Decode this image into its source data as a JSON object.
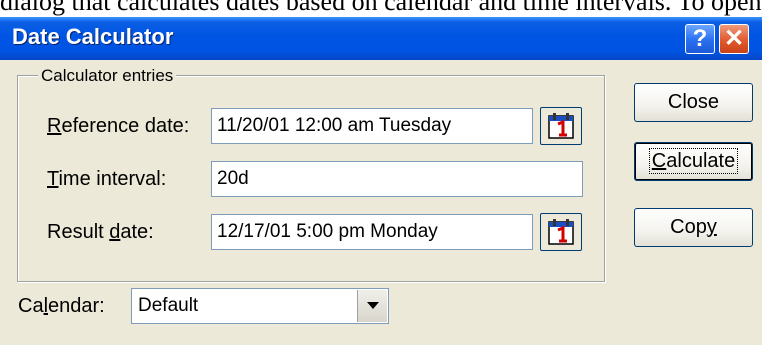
{
  "document": {
    "clipped_text": "dialog that calculates dates based on calendar and time intervals. To open it: Tools > Date Calculator"
  },
  "window": {
    "title": "Date Calculator",
    "help_glyph": "?",
    "close_glyph": "✕"
  },
  "group": {
    "legend": "Calculator entries"
  },
  "fields": {
    "reference": {
      "label_mnemonic": "R",
      "label_rest": "eference date:",
      "value": "11/20/01 12:00 am Tuesday"
    },
    "interval": {
      "label_mnemonic": "T",
      "label_rest": "ime interval:",
      "value": "20d"
    },
    "result": {
      "label_prefix": "Result ",
      "label_mnemonic": "d",
      "label_rest": "ate:",
      "value": "12/17/01 5:00 pm Monday"
    }
  },
  "buttons": {
    "close": "Close",
    "calculate_mnemonic": "C",
    "calculate_rest": "alculate",
    "copy_prefix": "Cop",
    "copy_mnemonic": "y"
  },
  "calendar": {
    "label_prefix": "Ca",
    "label_mnemonic": "l",
    "label_rest": "endar:",
    "selected": "Default"
  },
  "icons": {
    "calendar_picker": "calendar-icon",
    "dropdown": "chevron-down-icon",
    "help": "help-icon",
    "close": "close-icon"
  },
  "colors": {
    "titlebar": "#0054e3",
    "dialog_face": "#ece9d8",
    "close_button": "#e05a2d",
    "field_border": "#7f9db9"
  }
}
